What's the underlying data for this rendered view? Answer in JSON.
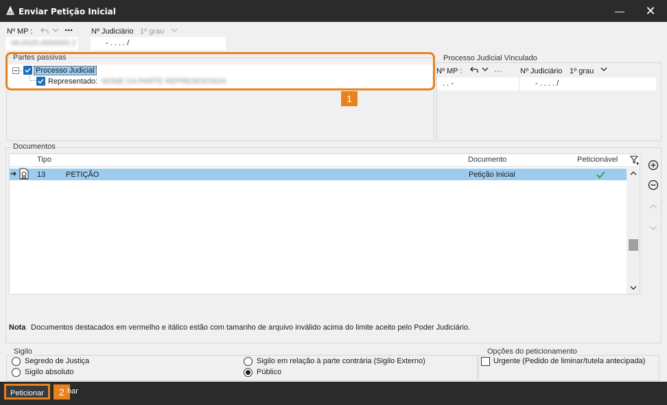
{
  "window": {
    "title": "Enviar Petição Inicial",
    "minimize_icon": "—",
    "close_icon": "✕"
  },
  "top": {
    "nmp_label": "Nº MP :",
    "nmp_value": "06.0025.0000000.2",
    "njud_label": "Nº Judiciário",
    "njud_grau": "1º grau",
    "njud_value": "- .  . . .  /"
  },
  "partes": {
    "title": "Partes passivas",
    "tree": {
      "root_label": "Processo Judicial",
      "child_label": "Representado:",
      "child_value": "NOME DA PARTE REPRESENTADA"
    }
  },
  "vinculado": {
    "title": "Processo Judicial Vinculado",
    "nmp_label": "Nº MP :",
    "nmp_value": ". .       -",
    "njud_label": "Nº Judiciário",
    "njud_grau": "1º grau",
    "njud_value": "- .  . . .  /"
  },
  "annotations": {
    "badge1": "1",
    "badge2": "2"
  },
  "documentos": {
    "title": "Documentos",
    "columns": {
      "tipo": "Tipo",
      "documento": "Documento",
      "peticionavel": "Peticionável"
    },
    "rows": [
      {
        "num": "13",
        "tipo": "PETIÇÃO",
        "documento": "Petição Inicial",
        "peticionavel": true
      }
    ]
  },
  "nota": {
    "label": "Nota",
    "text": "Documentos destacados em vermelho e itálico estão com tamanho de arquivo inválido acima do limite aceito pelo Poder Judiciário."
  },
  "sigilo": {
    "title": "Sigilo",
    "options": [
      "Segredo de Justiça",
      "Sigilo absoluto",
      "Sigilo em relação à parte contrária (Sigilo Externo)",
      "Público"
    ],
    "selected": "Público"
  },
  "opcoes": {
    "title": "Opções do peticionamento",
    "urgente_label": "Urgente (Pedido de liminar/tutela antecipada)",
    "urgente_checked": false
  },
  "footer": {
    "peticionar_label": "Peticionar",
    "fechar_label": "har"
  },
  "colors": {
    "accent_orange": "#e8821e",
    "selection": "#9ccbee",
    "checkbox_blue": "#1b6ec2",
    "titlebar": "#2b2b2b"
  },
  "icons": [
    "app-icon",
    "undo-icon",
    "chevron-down-icon",
    "more-icon",
    "collapse-icon",
    "arrow-right-icon",
    "document-seal-icon",
    "check-icon",
    "filter-icon",
    "add-icon",
    "remove-icon",
    "chevron-up-icon"
  ]
}
